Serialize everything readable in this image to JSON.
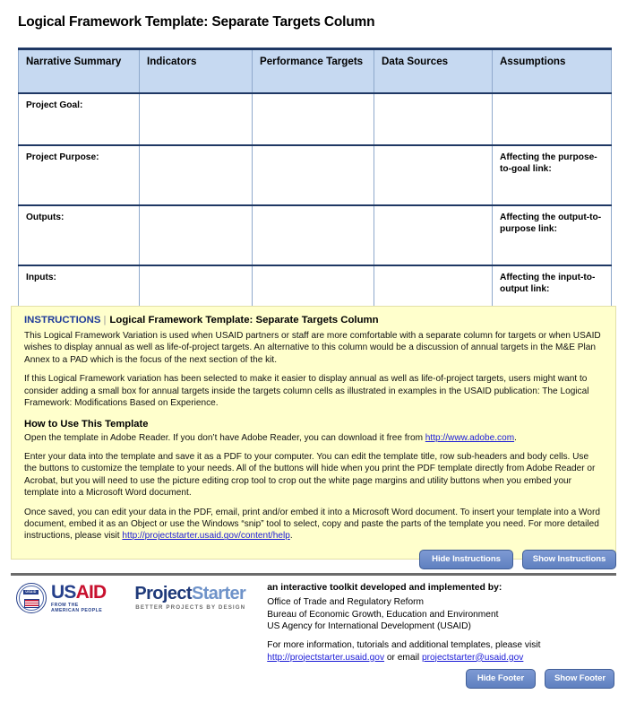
{
  "page": {
    "title": "Logical Framework Template: Separate Targets Column"
  },
  "table": {
    "columns": [
      "Narrative Summary",
      "Indicators",
      "Performance Targets",
      "Data Sources",
      "Assumptions"
    ],
    "rows": [
      {
        "narrative": "Project Goal:",
        "indicators": "",
        "targets": "",
        "sources": "",
        "assumptions": ""
      },
      {
        "narrative": "Project Purpose:",
        "indicators": "",
        "targets": "",
        "sources": "",
        "assumptions": "Affecting the purpose-to-goal link:"
      },
      {
        "narrative": "Outputs:",
        "indicators": "",
        "targets": "",
        "sources": "",
        "assumptions": "Affecting the output-to-purpose link:"
      },
      {
        "narrative": "Inputs:",
        "indicators": "",
        "targets": "",
        "sources": "",
        "assumptions": "Affecting the input-to-output link:"
      }
    ]
  },
  "instructions": {
    "label": "INSTRUCTIONS",
    "separator": "|",
    "title": "Logical Framework Template: Separate Targets Column",
    "paragraph1": "This Logical Framework Variation is used when USAID partners or staff are more comfortable with a separate column for targets or when USAID wishes to display annual as well as life-of-project targets. An alternative to this column would be a discussion of annual targets in the M&E Plan Annex to a PAD which is the focus of the next section of the kit.",
    "paragraph2": "If this Logical Framework variation has been selected to make it easier to display annual as well as life-of-project targets, users might want to consider adding a small box for annual targets inside the targets column cells as illustrated in examples in the USAID publication: The Logical Framework: Modifications Based on Experience.",
    "how_to_heading": "How to Use This Template",
    "how_to_p1_before": "Open the template in Adobe Reader. If you don’t have Adobe Reader, you can download it free from ",
    "how_to_p1_link": "http://www.adobe.com",
    "how_to_p1_after": ".",
    "how_to_p2": "Enter your data into the template and save it as a PDF to your computer. You can edit the template title, row sub-headers and body cells. Use the buttons to customize the template to your needs. All of the buttons will hide when you print the PDF template directly from Adobe Reader or Acrobat, but you will need to use the picture editing crop tool to crop out the white page margins and utility buttons when you embed your template into a Microsoft Word document.",
    "how_to_p3_before": "Once saved, you can edit your data in the PDF, email, print and/or embed it into a Microsoft Word document. To insert your template into a Word document, embed it as an Object or use the Windows “snip” tool to select, copy and paste the parts of the template you need. For more detailed instructions, please visit ",
    "how_to_p3_link": "http://projectstarter.usaid.gov/content/help",
    "how_to_p3_after": ".",
    "hide_button": "Hide Instructions",
    "show_button": "Show Instructions"
  },
  "footer": {
    "usaid_logo": {
      "seal_text": "USAID",
      "word_first": "US",
      "word_second": "AID",
      "tagline": "FROM THE AMERICAN PEOPLE"
    },
    "projectstarter_logo": {
      "word_first": "Project",
      "word_second": "Starter",
      "tagline": "BETTER PROJECTS BY DESIGN"
    },
    "lead": "an interactive toolkit developed and implemented by:",
    "line1": "Office of Trade and Regulatory Reform",
    "line2": "Bureau of Economic Growth, Education and Environment",
    "line3": "US Agency for International Development (USAID)",
    "contact_before": "For more information, tutorials and additional templates, please visit ",
    "contact_link": "http://projectstarter.usaid.gov",
    "contact_middle": " or email ",
    "contact_email": "projectstarter@usaid.gov",
    "hide_button": "Hide Footer",
    "show_button": "Show Footer"
  },
  "colors": {
    "header_fill": "#c6d9f1",
    "table_rule": "#1f3864",
    "instructions_fill": "#ffffcc",
    "button_fill": "#6f8fcb",
    "link": "#1a1ad6",
    "usaid_blue": "#26408b",
    "usaid_red": "#c8102e"
  }
}
